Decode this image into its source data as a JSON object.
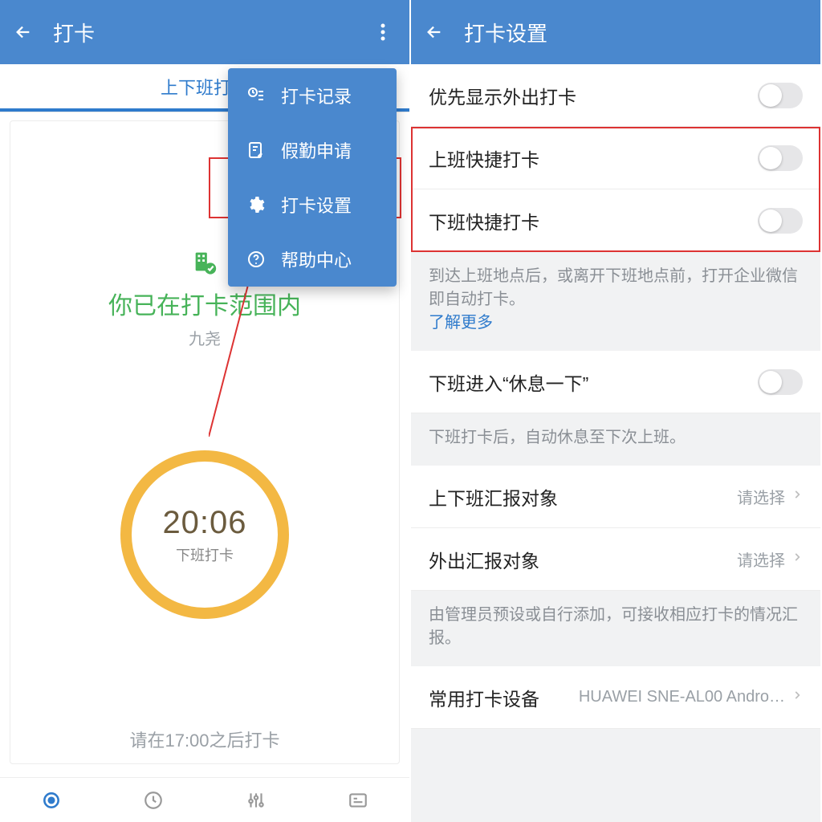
{
  "left": {
    "header": {
      "title": "打卡"
    },
    "tab_label": "上下班打卡",
    "menu": {
      "items": [
        {
          "label": "打卡记录"
        },
        {
          "label": "假勤申请"
        },
        {
          "label": "打卡设置"
        },
        {
          "label": "帮助中心"
        }
      ]
    },
    "status_line": "你已在打卡范围内",
    "username": "九尧",
    "clock": {
      "time": "20:06",
      "label": "下班打卡"
    },
    "bottom_hint": "请在17:00之后打卡"
  },
  "right": {
    "header": {
      "title": "打卡设置"
    },
    "rows": {
      "priority_outside": "优先显示外出打卡",
      "quick_on": "上班快捷打卡",
      "quick_off": "下班快捷打卡",
      "note1": "到达上班地点后，或离开下班地点前，打开企业微信即自动打卡。",
      "learn_more": "了解更多",
      "rest_after_off": "下班进入“休息一下”",
      "note2": "下班打卡后，自动休息至下次上班。",
      "report_target_work": "上下班汇报对象",
      "report_target_out": "外出汇报对象",
      "please_select": "请选择",
      "note3": "由管理员预设或自行添加，可接收相应打卡的情况汇报。",
      "devices_label": "常用打卡设备",
      "devices_value": "HUAWEI SNE-AL00 Andro…"
    }
  }
}
